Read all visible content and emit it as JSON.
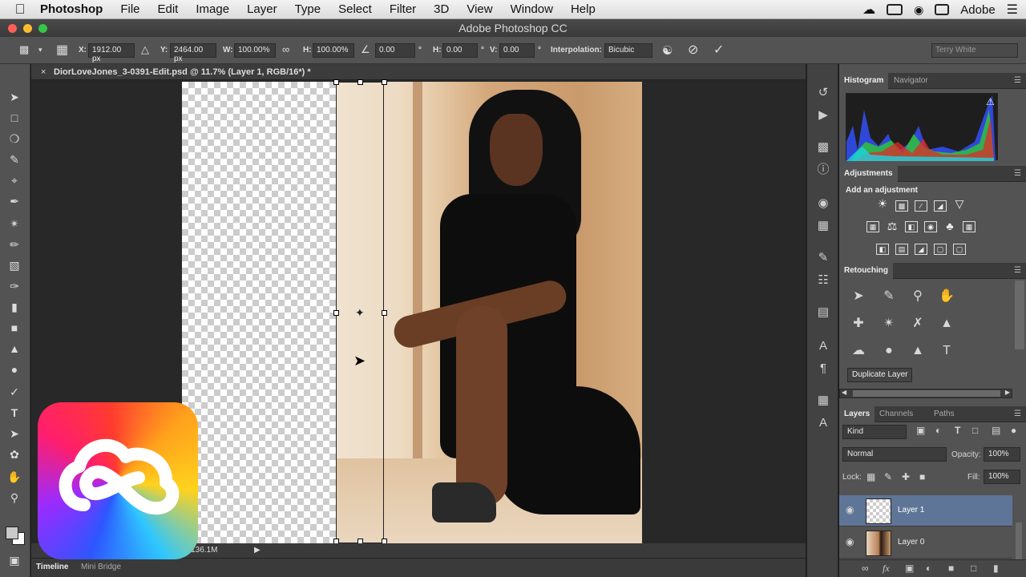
{
  "menubar": {
    "app_name": "Photoshop",
    "items": [
      "File",
      "Edit",
      "Image",
      "Layer",
      "Type",
      "Select",
      "Filter",
      "3D",
      "View",
      "Window",
      "Help"
    ],
    "user": "Adobe"
  },
  "window": {
    "title": "Adobe Photoshop CC"
  },
  "options": {
    "x_label": "X:",
    "x_value": "1912.00 px",
    "y_label": "Y:",
    "y_value": "2464.00 px",
    "w_label": "W:",
    "w_value": "100.00%",
    "h_label": "H:",
    "h_value": "100.00%",
    "angle_value": "0.00",
    "deg": "°",
    "hskew_label": "H:",
    "hskew_value": "0.00",
    "vskew_label": "V:",
    "vskew_value": "0.00",
    "interp_label": "Interpolation:",
    "interp_value": "Bicubic",
    "workspace": "Terry White"
  },
  "document": {
    "tab_title": "DiorLoveJones_3-0391-Edit.psd @ 11.7% (Layer 1, RGB/16*) *",
    "close_glyph": "×",
    "status": "M/136.1M"
  },
  "bottom_tabs": [
    "Timeline",
    "Mini Bridge"
  ],
  "histogram_panel": {
    "tabs": [
      "Histogram",
      "Navigator"
    ]
  },
  "adjustments_panel": {
    "title": "Adjustments",
    "subtitle": "Add an adjustment"
  },
  "retouching_panel": {
    "title": "Retouching",
    "tooltip": "Duplicate Layer"
  },
  "layers_panel": {
    "tabs": [
      "Layers",
      "Channels",
      "Paths"
    ],
    "filter": "Kind",
    "blend_mode": "Normal",
    "opacity_label": "Opacity:",
    "opacity_value": "100%",
    "lock_label": "Lock:",
    "fill_label": "Fill:",
    "fill_value": "100%",
    "layers": [
      {
        "name": "Layer 1",
        "selected": true
      },
      {
        "name": "Layer 0",
        "selected": false
      }
    ],
    "fx_label": "fx"
  },
  "colors": {
    "selection": "#5f7597",
    "panel_bg": "#535353",
    "canvas_bg": "#282828"
  }
}
